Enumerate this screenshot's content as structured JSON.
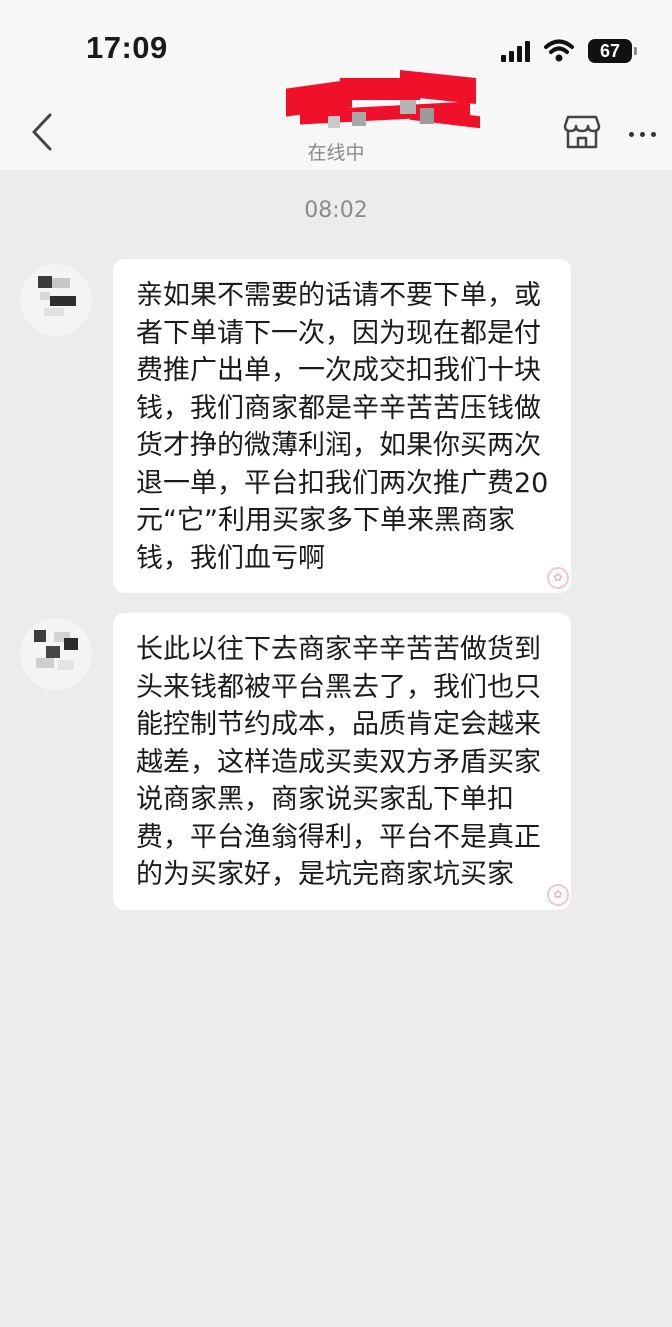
{
  "status_bar": {
    "time": "17:09",
    "battery": "67"
  },
  "header": {
    "subtitle": "在线中",
    "icons": {
      "back": "chevron-left-icon",
      "shop": "storefront-icon",
      "more": "more-horizontal-icon"
    }
  },
  "chat": {
    "timestamp": "08:02",
    "messages": [
      {
        "sender": "other",
        "text": "亲如果不需要的话请不要下单，或者下单请下一次，因为现在都是付费推广出单，一次成交扣我们十块钱，我们商家都是辛辛苦苦压钱做货才挣的微薄利润，如果你买两次退一单，平台扣我们两次推广费20元“它”利用买家多下单来黑商家钱，我们血亏啊"
      },
      {
        "sender": "other",
        "text": "长此以往下去商家辛辛苦苦做货到头来钱都被平台黑去了，我们也只能控制节约成本，品质肯定会越来越差，这样造成买卖双方矛盾买家说商家黑，商家说买家乱下单扣费，平台渔翁得利，平台不是真正的为买家好，是坑完商家坑买家"
      }
    ]
  },
  "colors": {
    "background": "#ececec",
    "bubble": "#ffffff",
    "header": "#f7f7f7",
    "redaction": "#f0102a"
  }
}
